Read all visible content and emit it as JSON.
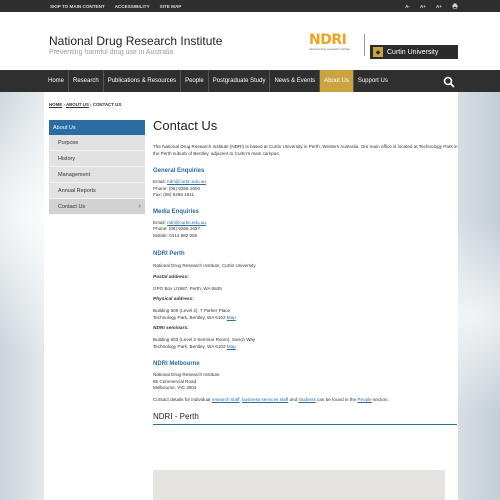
{
  "utility": {
    "skip": "SKIP TO MAIN CONTENT",
    "accessibility": "ACCESSIBILITY",
    "sitemap": "SITE MAP",
    "font_small": "A-",
    "font_medium": "A+",
    "font_large": "A+",
    "print_icon": "printer-icon"
  },
  "header": {
    "title": "National Drug Research Institute",
    "tagline": "Preventing harmful drug use in Australia",
    "ndri_logo": "NDRI",
    "ndri_logo_sub": "national drug research institute",
    "curtin_logo": "Curtin University"
  },
  "nav": {
    "items": [
      "Home",
      "Research",
      "Publications & Resources",
      "People",
      "Postgraduate Study",
      "News & Events",
      "About Us",
      "Support Us"
    ],
    "active": "About Us",
    "search_icon": "search-icon"
  },
  "breadcrumb": {
    "home": "HOME",
    "about": "ABOUT US",
    "current": "CONTACT US",
    "sep": "›"
  },
  "sidenav": {
    "top": "About Us",
    "items": [
      "Purpose",
      "History",
      "Management",
      "Annual Reports",
      "Contact Us"
    ],
    "current": "Contact Us"
  },
  "main": {
    "title": "Contact Us",
    "intro": "The National Drug Research Institute (NDRI) is based at Curtin University in Perth, Western Australia. Our main office is located at Technology Park in the Perth suburb of Bentley, adjacent to Curtin's main campus.",
    "general": {
      "heading": "General Enquiries",
      "email_label": "Email: ",
      "email": "ndri@curtin.edu.au",
      "phone": "Phone: (08) 9266 1600",
      "fax": "Fax: (08) 9266 1611"
    },
    "media": {
      "heading": "Media Enquiries",
      "email_label": "Email: ",
      "email": "ndri@curtin.edu.au",
      "phone": "Phone: (08) 9266 1627",
      "mobile": "Mobile: 0414 682 055"
    },
    "perth": {
      "heading": "NDRI Perth",
      "org": "National Drug Research Institute, Curtin University",
      "postal_label": "Postal address:",
      "postal": "GPO Box U1987, Perth, WA 6845",
      "physical_label": "Physical address:",
      "physical_1": "Building 609 (Level 2), 7 Parker Place",
      "physical_2": "Technology Park, Bentley, WA 6102 ",
      "map_link": "Map",
      "seminars_label": "NDRI seminars:",
      "seminars_1": "Building 603 (Level 2 Seminar Room), Sarich Way",
      "seminars_2": "Technology Park, Bentley, WA 6102 ",
      "map_link_2": "Map"
    },
    "melbourne": {
      "heading": "NDRI Melbourne",
      "line_1": "National Drug Research Institute",
      "line_2": "85 Commercial Road",
      "line_3": "Melbourne, VIC 3004"
    },
    "people_note": {
      "prefix": "Contact details for individual ",
      "research_staff": "research staff",
      "comma": ", ",
      "business_staff": "business services staff",
      "and": " and ",
      "students": "students",
      "middle": " can be found in the ",
      "people": "People",
      "suffix": " section."
    },
    "map_heading": "NDRI - Perth"
  }
}
